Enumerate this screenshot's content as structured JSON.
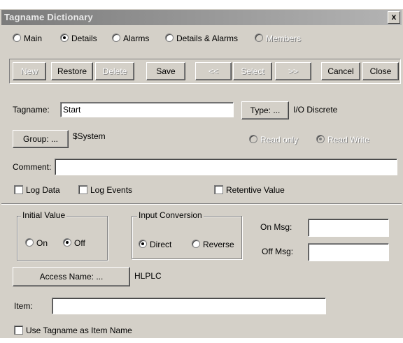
{
  "window": {
    "title": "Tagname Dictionary",
    "close": "x"
  },
  "view_modes": [
    {
      "label": "Main",
      "selected": false,
      "enabled": true
    },
    {
      "label": "Details",
      "selected": true,
      "enabled": true
    },
    {
      "label": "Alarms",
      "selected": false,
      "enabled": true
    },
    {
      "label": "Details & Alarms",
      "selected": false,
      "enabled": true
    },
    {
      "label": "Members",
      "selected": false,
      "enabled": false
    }
  ],
  "toolbar": {
    "new": "New",
    "restore": "Restore",
    "delete": "Delete",
    "save": "Save",
    "prev": "<<",
    "select": "Select",
    "next": ">>",
    "cancel": "Cancel",
    "close": "Close"
  },
  "tag": {
    "tagname_label": "Tagname:",
    "tagname_value": "Start",
    "type_button": "Type: ...",
    "type_value": "I/O Discrete",
    "group_button": "Group: ...",
    "group_value": "$System",
    "read_only": "Read only",
    "read_write": "Read Write",
    "comment_label": "Comment:",
    "comment_value": ""
  },
  "options": {
    "log_data": "Log Data",
    "log_events": "Log Events",
    "retentive": "Retentive Value"
  },
  "initial_value": {
    "title": "Initial Value",
    "on": "On",
    "off": "Off",
    "selected": "Off"
  },
  "input_conversion": {
    "title": "Input Conversion",
    "direct": "Direct",
    "reverse": "Reverse",
    "selected": "Direct"
  },
  "messages": {
    "on_label": "On Msg:",
    "off_label": "Off Msg:",
    "on_value": "",
    "off_value": ""
  },
  "access": {
    "button": "Access Name: ...",
    "value": "HLPLC"
  },
  "item": {
    "label": "Item:",
    "value": ""
  },
  "use_tagname": {
    "label": "Use Tagname as Item Name"
  }
}
